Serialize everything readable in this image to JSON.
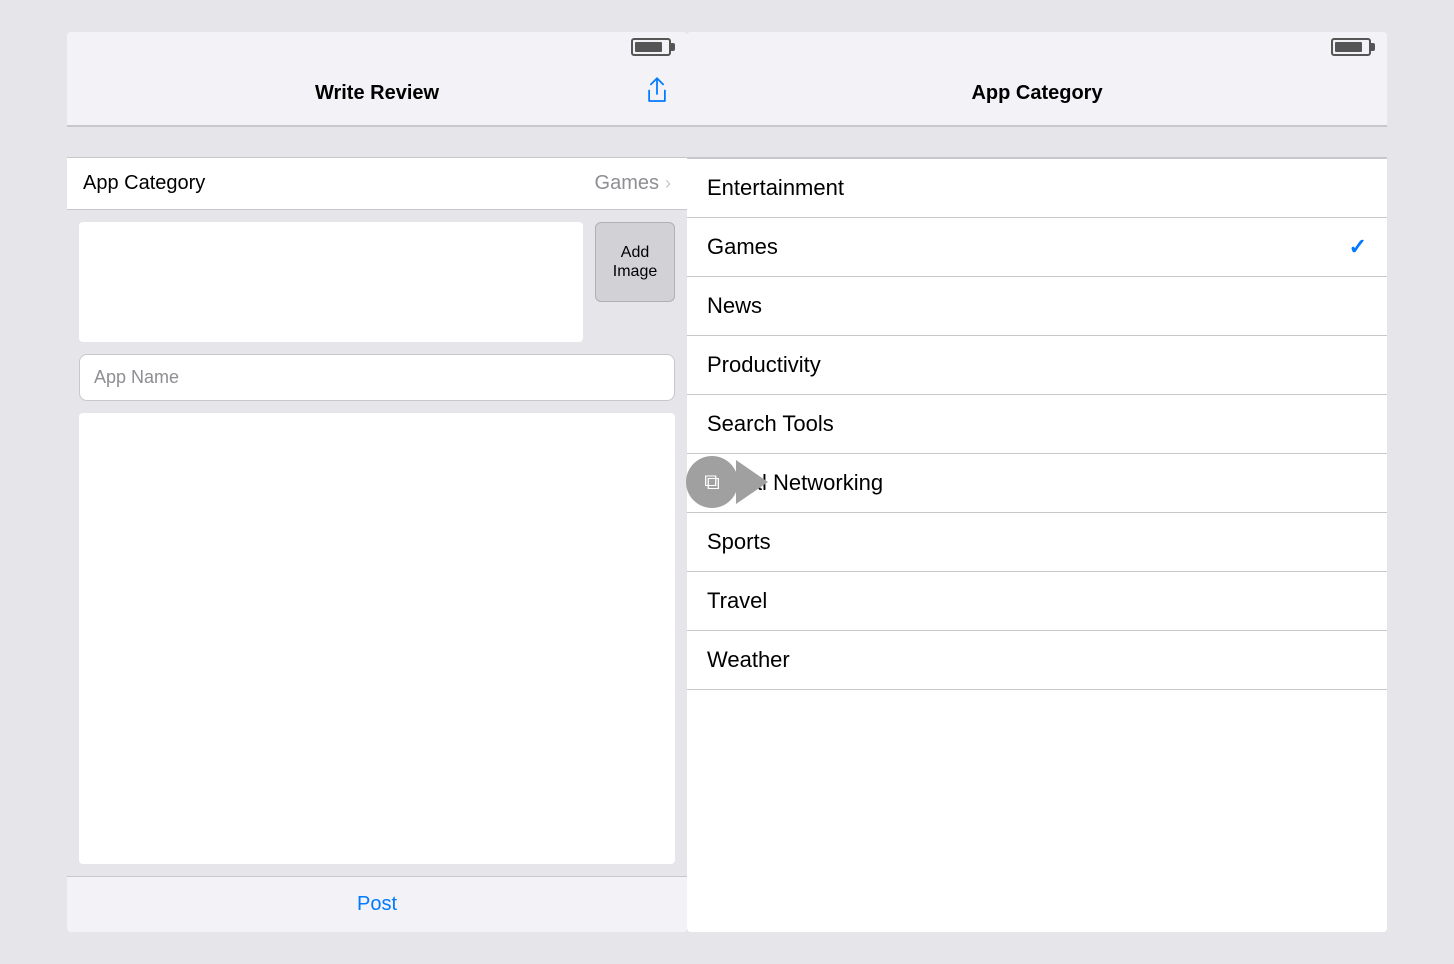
{
  "left_screen": {
    "status_bar": {
      "battery": "battery"
    },
    "nav": {
      "title": "Write Review",
      "share_label": "share"
    },
    "category_row": {
      "label": "App Category",
      "value": "Games"
    },
    "image_area": {
      "add_button_label": "Add\nImage"
    },
    "app_name_placeholder": "App Name",
    "post_bar": {
      "label": "Post"
    }
  },
  "right_screen": {
    "status_bar": {
      "battery": "battery"
    },
    "nav": {
      "title": "App Category"
    },
    "categories": [
      {
        "label": "Entertainment",
        "selected": false
      },
      {
        "label": "Games",
        "selected": true
      },
      {
        "label": "News",
        "selected": false
      },
      {
        "label": "Productivity",
        "selected": false
      },
      {
        "label": "Search Tools",
        "selected": false
      },
      {
        "label": "Social Networking",
        "selected": false
      },
      {
        "label": "Sports",
        "selected": false
      },
      {
        "label": "Travel",
        "selected": false
      },
      {
        "label": "Weather",
        "selected": false
      }
    ]
  },
  "colors": {
    "blue": "#007aff",
    "gray": "#8e8e93",
    "separator": "#c8c8cc",
    "background": "#e5e5ea"
  }
}
